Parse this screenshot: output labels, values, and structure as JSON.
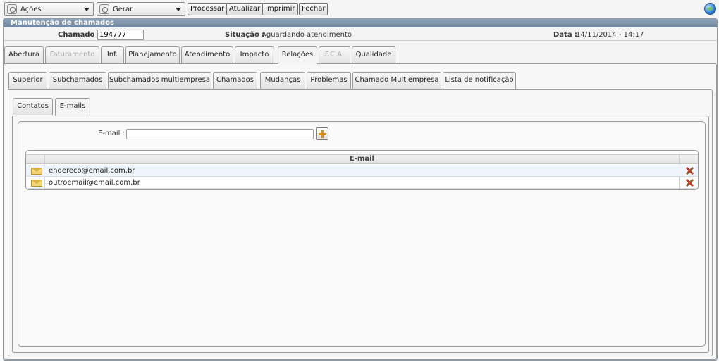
{
  "toolbar": {
    "acoes_label": "Ações",
    "gerar_label": "Gerar",
    "processar_label": "Processar",
    "atualizar_label": "Atualizar",
    "imprimir_label": "Imprimir",
    "fechar_label": "Fechar"
  },
  "window": {
    "title": "Manutenção de chamados"
  },
  "info": {
    "chamado_label": "Chamado :",
    "chamado_value": "194777",
    "situacao_label": "Situação :",
    "situacao_value": "Aguardando atendimento",
    "data_label": "Data :",
    "data_value": "14/11/2014 - 14:17"
  },
  "main_tabs": [
    "Abertura",
    "Faturamento",
    "Inf.",
    "Planejamento",
    "Atendimento",
    "Impacto",
    "Relações",
    "F.C.A.",
    "Qualidade"
  ],
  "relacoes_tabs": [
    "Superior",
    "Subchamados",
    "Subchamados multiempresa",
    "Chamados",
    "Mudanças",
    "Problemas",
    "Chamado Multiempresa",
    "Lista de notificação"
  ],
  "notif_tabs": [
    "Contatos",
    "E-mails"
  ],
  "email_form": {
    "label": "E-mail :",
    "value": ""
  },
  "email_grid": {
    "header": "E-mail",
    "rows": [
      "endereco@email.com.br",
      "outroemail@email.com.br"
    ]
  }
}
